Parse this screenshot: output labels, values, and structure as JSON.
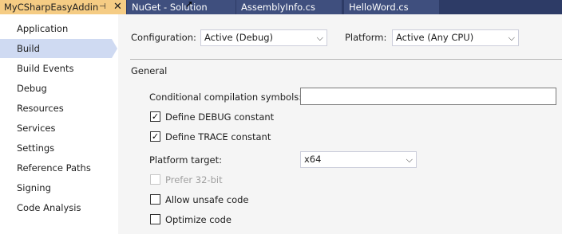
{
  "tabs": [
    {
      "label": "MyCSharpEasyAddin",
      "active": true
    },
    {
      "label": "NuGet - Solution",
      "active": false
    },
    {
      "label": "AssemblyInfo.cs",
      "active": false
    },
    {
      "label": "HelloWord.cs",
      "active": false
    }
  ],
  "sidebar": {
    "items": [
      {
        "label": "Application"
      },
      {
        "label": "Build",
        "selected": true
      },
      {
        "label": "Build Events"
      },
      {
        "label": "Debug"
      },
      {
        "label": "Resources"
      },
      {
        "label": "Services"
      },
      {
        "label": "Settings"
      },
      {
        "label": "Reference Paths"
      },
      {
        "label": "Signing"
      },
      {
        "label": "Code Analysis"
      }
    ]
  },
  "config": {
    "configuration_label": "Configuration:",
    "configuration_value": "Active (Debug)",
    "platform_label": "Platform:",
    "platform_value": "Active (Any CPU)"
  },
  "general": {
    "title": "General",
    "symbols_label": "Conditional compilation symbols:",
    "symbols_value": "",
    "define_debug": {
      "label": "Define DEBUG constant",
      "checked": true
    },
    "define_trace": {
      "label": "Define TRACE constant",
      "checked": true
    },
    "platform_target_label": "Platform target:",
    "platform_target_value": "x64",
    "prefer32": {
      "label": "Prefer 32-bit",
      "checked": false,
      "enabled": false
    },
    "unsafe": {
      "label": "Allow unsafe code",
      "checked": false
    },
    "optimize": {
      "label": "Optimize code",
      "checked": false
    }
  },
  "glyphs": {
    "check": "✓",
    "chevron": "⌵",
    "pin": "⊣",
    "close": "✕",
    "cursor": "➚"
  },
  "colors": {
    "tab_active": "#f5cc84",
    "tab_strip": "#2d3b66",
    "tab_inactive": "#3f4f7e",
    "nav_selected": "#cfdaf2",
    "content_bg": "#f5f5f5"
  }
}
